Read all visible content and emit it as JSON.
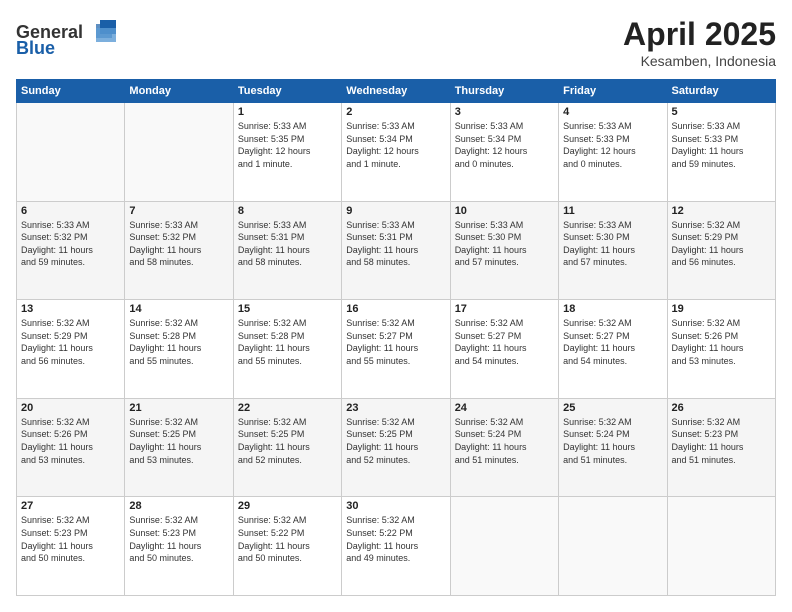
{
  "header": {
    "logo_general": "General",
    "logo_blue": "Blue",
    "title": "April 2025",
    "location": "Kesamben, Indonesia"
  },
  "weekdays": [
    "Sunday",
    "Monday",
    "Tuesday",
    "Wednesday",
    "Thursday",
    "Friday",
    "Saturday"
  ],
  "weeks": [
    [
      {
        "day": "",
        "info": ""
      },
      {
        "day": "",
        "info": ""
      },
      {
        "day": "1",
        "info": "Sunrise: 5:33 AM\nSunset: 5:35 PM\nDaylight: 12 hours\nand 1 minute."
      },
      {
        "day": "2",
        "info": "Sunrise: 5:33 AM\nSunset: 5:34 PM\nDaylight: 12 hours\nand 1 minute."
      },
      {
        "day": "3",
        "info": "Sunrise: 5:33 AM\nSunset: 5:34 PM\nDaylight: 12 hours\nand 0 minutes."
      },
      {
        "day": "4",
        "info": "Sunrise: 5:33 AM\nSunset: 5:33 PM\nDaylight: 12 hours\nand 0 minutes."
      },
      {
        "day": "5",
        "info": "Sunrise: 5:33 AM\nSunset: 5:33 PM\nDaylight: 11 hours\nand 59 minutes."
      }
    ],
    [
      {
        "day": "6",
        "info": "Sunrise: 5:33 AM\nSunset: 5:32 PM\nDaylight: 11 hours\nand 59 minutes."
      },
      {
        "day": "7",
        "info": "Sunrise: 5:33 AM\nSunset: 5:32 PM\nDaylight: 11 hours\nand 58 minutes."
      },
      {
        "day": "8",
        "info": "Sunrise: 5:33 AM\nSunset: 5:31 PM\nDaylight: 11 hours\nand 58 minutes."
      },
      {
        "day": "9",
        "info": "Sunrise: 5:33 AM\nSunset: 5:31 PM\nDaylight: 11 hours\nand 58 minutes."
      },
      {
        "day": "10",
        "info": "Sunrise: 5:33 AM\nSunset: 5:30 PM\nDaylight: 11 hours\nand 57 minutes."
      },
      {
        "day": "11",
        "info": "Sunrise: 5:33 AM\nSunset: 5:30 PM\nDaylight: 11 hours\nand 57 minutes."
      },
      {
        "day": "12",
        "info": "Sunrise: 5:32 AM\nSunset: 5:29 PM\nDaylight: 11 hours\nand 56 minutes."
      }
    ],
    [
      {
        "day": "13",
        "info": "Sunrise: 5:32 AM\nSunset: 5:29 PM\nDaylight: 11 hours\nand 56 minutes."
      },
      {
        "day": "14",
        "info": "Sunrise: 5:32 AM\nSunset: 5:28 PM\nDaylight: 11 hours\nand 55 minutes."
      },
      {
        "day": "15",
        "info": "Sunrise: 5:32 AM\nSunset: 5:28 PM\nDaylight: 11 hours\nand 55 minutes."
      },
      {
        "day": "16",
        "info": "Sunrise: 5:32 AM\nSunset: 5:27 PM\nDaylight: 11 hours\nand 55 minutes."
      },
      {
        "day": "17",
        "info": "Sunrise: 5:32 AM\nSunset: 5:27 PM\nDaylight: 11 hours\nand 54 minutes."
      },
      {
        "day": "18",
        "info": "Sunrise: 5:32 AM\nSunset: 5:27 PM\nDaylight: 11 hours\nand 54 minutes."
      },
      {
        "day": "19",
        "info": "Sunrise: 5:32 AM\nSunset: 5:26 PM\nDaylight: 11 hours\nand 53 minutes."
      }
    ],
    [
      {
        "day": "20",
        "info": "Sunrise: 5:32 AM\nSunset: 5:26 PM\nDaylight: 11 hours\nand 53 minutes."
      },
      {
        "day": "21",
        "info": "Sunrise: 5:32 AM\nSunset: 5:25 PM\nDaylight: 11 hours\nand 53 minutes."
      },
      {
        "day": "22",
        "info": "Sunrise: 5:32 AM\nSunset: 5:25 PM\nDaylight: 11 hours\nand 52 minutes."
      },
      {
        "day": "23",
        "info": "Sunrise: 5:32 AM\nSunset: 5:25 PM\nDaylight: 11 hours\nand 52 minutes."
      },
      {
        "day": "24",
        "info": "Sunrise: 5:32 AM\nSunset: 5:24 PM\nDaylight: 11 hours\nand 51 minutes."
      },
      {
        "day": "25",
        "info": "Sunrise: 5:32 AM\nSunset: 5:24 PM\nDaylight: 11 hours\nand 51 minutes."
      },
      {
        "day": "26",
        "info": "Sunrise: 5:32 AM\nSunset: 5:23 PM\nDaylight: 11 hours\nand 51 minutes."
      }
    ],
    [
      {
        "day": "27",
        "info": "Sunrise: 5:32 AM\nSunset: 5:23 PM\nDaylight: 11 hours\nand 50 minutes."
      },
      {
        "day": "28",
        "info": "Sunrise: 5:32 AM\nSunset: 5:23 PM\nDaylight: 11 hours\nand 50 minutes."
      },
      {
        "day": "29",
        "info": "Sunrise: 5:32 AM\nSunset: 5:22 PM\nDaylight: 11 hours\nand 50 minutes."
      },
      {
        "day": "30",
        "info": "Sunrise: 5:32 AM\nSunset: 5:22 PM\nDaylight: 11 hours\nand 49 minutes."
      },
      {
        "day": "",
        "info": ""
      },
      {
        "day": "",
        "info": ""
      },
      {
        "day": "",
        "info": ""
      }
    ]
  ],
  "row_shades": [
    false,
    true,
    false,
    true,
    false
  ]
}
